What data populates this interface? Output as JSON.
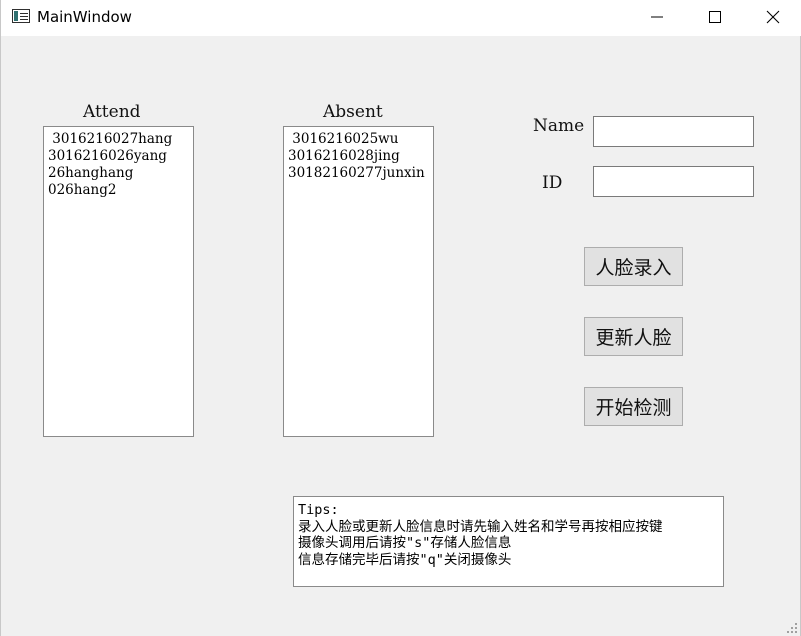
{
  "window": {
    "title": "MainWindow",
    "icon": "app-window-icon",
    "controls": [
      "minimize-icon",
      "maximize-icon",
      "close-icon"
    ]
  },
  "attend": {
    "label": "Attend",
    "items": [
      " 3016216027hang",
      "3016216026yang",
      "26hanghang",
      "026hang2"
    ]
  },
  "absent": {
    "label": "Absent",
    "items": [
      " 3016216025wu",
      "3016216028jing",
      "30182160277junxin"
    ]
  },
  "form": {
    "name_label": "Name",
    "name_value": "",
    "id_label": "ID",
    "id_value": ""
  },
  "buttons": {
    "enroll": "人脸录入",
    "update": "更新人脸",
    "start": "开始检测"
  },
  "tips": {
    "lines": [
      "Tips:",
      "录入人脸或更新人脸信息时请先输入姓名和学号再按相应按键",
      "摄像头调用后请按\"s\"存储人脸信息",
      "信息存储完毕后请按\"q\"关闭摄像头"
    ]
  }
}
